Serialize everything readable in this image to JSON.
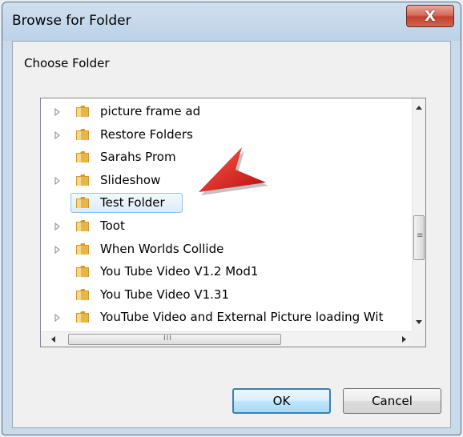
{
  "window": {
    "title": "Browse for Folder",
    "close_glyph": "X"
  },
  "dialog": {
    "prompt": "Choose Folder"
  },
  "tree": {
    "items": [
      {
        "label": "picture frame ad",
        "expandable": true
      },
      {
        "label": "Restore Folders",
        "expandable": true
      },
      {
        "label": "Sarahs Prom",
        "expandable": false
      },
      {
        "label": "Slideshow",
        "expandable": true
      },
      {
        "label": "Test Folder",
        "expandable": false,
        "selected": true
      },
      {
        "label": "Toot",
        "expandable": true
      },
      {
        "label": "When Worlds Collide",
        "expandable": true
      },
      {
        "label": "You Tube Video V1.2 Mod1",
        "expandable": false
      },
      {
        "label": "You Tube Video V1.31",
        "expandable": false
      },
      {
        "label": "YouTube Video and External Picture loading Wit",
        "expandable": true
      }
    ],
    "hscroll_thumb_glyph": "III",
    "vscroll_thumb_glyph": "≡"
  },
  "buttons": {
    "ok": "OK",
    "cancel": "Cancel"
  },
  "colors": {
    "folder": "#e8b54a",
    "selection_border": "#8dc3f0",
    "annotation_arrow": "#e02020"
  },
  "icons": {
    "folder": "folder-icon",
    "expander": "triangle-right-icon",
    "annotation": "red-arrow-icon"
  }
}
